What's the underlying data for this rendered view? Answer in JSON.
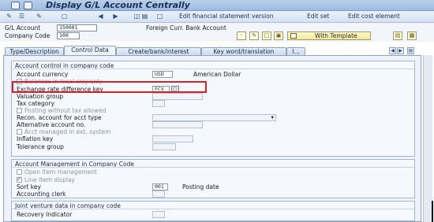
{
  "window": {
    "title": "Display G/L Account Centrally"
  },
  "toolbar": {
    "edit_fs_version": "Edit financial statement version",
    "edit_set": "Edit set",
    "edit_cost_element": "Edit cost element"
  },
  "header": {
    "gl_account_label": "G/L Account",
    "gl_account_value": "150001",
    "gl_account_desc": "Foreign Curr. Bank Account",
    "company_code_label": "Company Code",
    "company_code_value": "100",
    "with_template_label": "With Template"
  },
  "tabs": [
    {
      "label": "Type/Description"
    },
    {
      "label": "Control Data",
      "active": true
    },
    {
      "label": "Create/bank/interest"
    },
    {
      "label": "Key word/translation"
    },
    {
      "label": "I..."
    }
  ],
  "account_control": {
    "title": "Account control in company code",
    "account_currency_label": "Account currency",
    "account_currency_value": "USD",
    "account_currency_desc": "American Dollar",
    "balances_local_label": "Balances in local crcy only",
    "exchange_rate_label": "Exchange rate difference key",
    "exchange_rate_value": "FCV",
    "valuation_group_label": "Valuation group",
    "tax_category_label": "Tax category",
    "posting_wo_tax_label": "Posting without tax allowed",
    "recon_account_label": "Recon. account for acct type",
    "alternative_account_label": "Alternative account no.",
    "acct_managed_label": "Acct managed in ext. system",
    "inflation_key_label": "Inflation key",
    "tolerance_group_label": "Tolerance group"
  },
  "account_management": {
    "title": "Account Management in Company Code",
    "open_item_label": "Open item management",
    "line_item_label": "Line item display",
    "sort_key_label": "Sort key",
    "sort_key_value": "001",
    "sort_key_desc": "Posting date",
    "accounting_clerk_label": "Accounting clerk"
  },
  "joint_venture": {
    "title": "Joint venture data in company code",
    "recovery_indicator_label": "Recovery Indicator"
  },
  "colors": {
    "highlight": "#d9202a",
    "title_text": "#1b2f56"
  }
}
